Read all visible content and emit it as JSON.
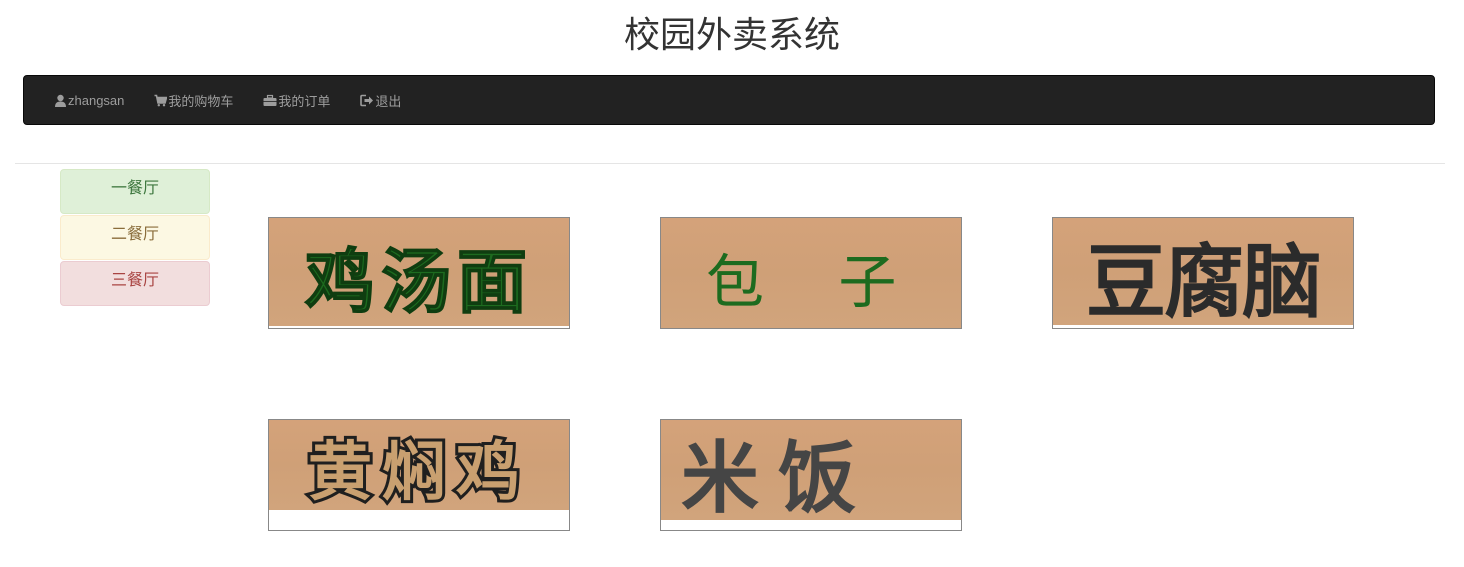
{
  "app": {
    "title": "校园外卖系统"
  },
  "navbar": {
    "user": {
      "label": "zhangsan",
      "icon": "user-icon"
    },
    "cart": {
      "label": "我的购物车",
      "icon": "cart-icon"
    },
    "orders": {
      "label": "我的订单",
      "icon": "briefcase-icon"
    },
    "logout": {
      "label": "退出",
      "icon": "logout-icon"
    }
  },
  "canteens": [
    {
      "label": "一餐厅",
      "color": "#3c763d"
    },
    {
      "label": "二餐厅",
      "color": "#8a6d3b"
    },
    {
      "label": "三餐厅",
      "color": "#a94442"
    }
  ],
  "dishes": [
    {
      "name": "鸡汤面",
      "text_color": "#1d6b1f"
    },
    {
      "name": "包 子",
      "text_color": "#1d6b1f"
    },
    {
      "name": "豆腐脑",
      "text_color": "#2b2b2b"
    },
    {
      "name": "黄焖鸡",
      "text_color": "#2b2b2b"
    },
    {
      "name": "米 饭",
      "text_color": "#454545"
    }
  ]
}
